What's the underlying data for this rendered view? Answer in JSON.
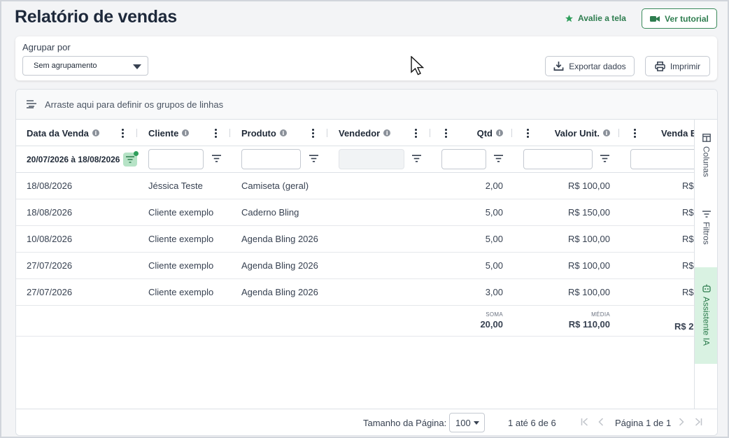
{
  "page": {
    "title": "Relatório de vendas"
  },
  "header": {
    "rate_label": "Avalie a tela",
    "tutorial_label": "Ver tutorial"
  },
  "grouping": {
    "label": "Agrupar por",
    "selected": "Sem agrupamento",
    "export_label": "Exportar dados",
    "print_label": "Imprimir"
  },
  "grid": {
    "drop_zone_text": "Arraste aqui para definir os grupos de linhas",
    "columns": {
      "date": "Data da Venda",
      "client": "Cliente",
      "product": "Produto",
      "seller": "Vendedor",
      "qty": "Qtd",
      "unit": "Valor Unit.",
      "sale": "Venda B"
    },
    "date_filter": "20/07/2026 à 18/08/2026",
    "rows": [
      {
        "date": "18/08/2026",
        "client": "Jéssica Teste",
        "product": "Camiseta (geral)",
        "qty": "2,00",
        "unit": "R$ 100,00",
        "sale": "R$"
      },
      {
        "date": "18/08/2026",
        "client": "Cliente exemplo",
        "product": "Caderno Bling",
        "qty": "5,00",
        "unit": "R$ 150,00",
        "sale": "R$"
      },
      {
        "date": "10/08/2026",
        "client": "Cliente exemplo",
        "product": "Agenda Bling 2026",
        "qty": "5,00",
        "unit": "R$ 100,00",
        "sale": "R$"
      },
      {
        "date": "27/07/2026",
        "client": "Cliente exemplo",
        "product": "Agenda Bling 2026",
        "qty": "5,00",
        "unit": "R$ 100,00",
        "sale": "R$"
      },
      {
        "date": "27/07/2026",
        "client": "Cliente exemplo",
        "product": "Agenda Bling 2026",
        "qty": "3,00",
        "unit": "R$ 100,00",
        "sale": "R$"
      }
    ],
    "footer": {
      "qty_label": "SOMA",
      "qty_value": "20,00",
      "unit_label": "MÉDIA",
      "unit_value": "R$ 110,00",
      "sale_value": "R$ 2"
    },
    "side_tabs": {
      "columns": "Colunas",
      "filters": "Filtros",
      "assistant": "Assistente IA"
    },
    "pager": {
      "page_size_label": "Tamanho da Página:",
      "page_size": "100",
      "range": "1 até 6 de 6",
      "page_info": "Página 1 de 1"
    }
  },
  "colors": {
    "brand_green": "#2e7d4f",
    "accent_green_bg": "#d9f2e2",
    "title": "#1e293b"
  }
}
